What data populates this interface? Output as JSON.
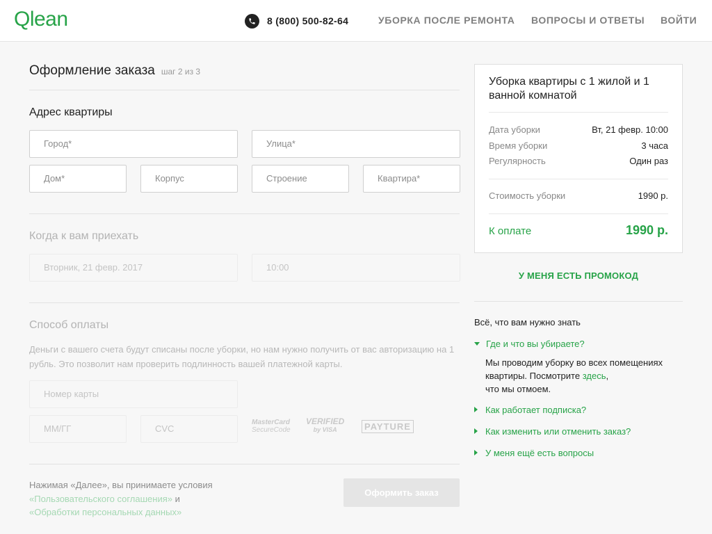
{
  "header": {
    "logo": "Qlean",
    "phone": "8 (800) 500-82-64",
    "nav": [
      "Уборка после ремонта",
      "Вопросы и ответы",
      "Войти"
    ]
  },
  "colors": {
    "accent": "#27a348",
    "background": "#f7f7f7"
  },
  "icons": {
    "phone": "phone-icon"
  },
  "checkout": {
    "title": "Оформление заказа",
    "step": "шаг 2 из 3",
    "address": {
      "heading": "Адрес квартиры",
      "city_placeholder": "Город*",
      "street_placeholder": "Улица*",
      "house_placeholder": "Дом*",
      "building_placeholder": "Корпус",
      "structure_placeholder": "Строение",
      "apartment_placeholder": "Квартира*"
    },
    "when": {
      "heading": "Когда к вам приехать",
      "date": "Вторник, 21 февр. 2017",
      "time": "10:00"
    },
    "payment": {
      "heading": "Способ оплаты",
      "note": "Деньги с вашего счета будут списаны после уборки, но нам нужно получить от вас авторизацию на 1 рубль. Это позволит нам проверить подлинность вашей платежной карты.",
      "card_placeholder": "Номер карты",
      "expiry_placeholder": "ММ/ГГ",
      "cvc_placeholder": "CVC",
      "logos": {
        "mastercard": "MasterCard",
        "mastercard_sub": "SecureCode",
        "verified": "VERIFIED",
        "verified_sub": "by VISA",
        "payture": "PAYTURE"
      }
    },
    "terms": {
      "text_before": "Нажимая «Далее», вы принимаете условия",
      "link1": "«Пользовательского соглашения»",
      "and": "и",
      "link2": "«Обработки персональных данных»"
    },
    "submit_label": "Оформить заказ"
  },
  "summary": {
    "title": "Уборка квартиры с 1 жилой и 1 ванной комнатой",
    "rows": [
      {
        "label": "Дата уборки",
        "value": "Вт, 21 февр. 10:00"
      },
      {
        "label": "Время уборки",
        "value": "3 часа"
      },
      {
        "label": "Регулярность",
        "value": "Один раз"
      }
    ],
    "cost_label": "Стоимость уборки",
    "cost_value": "1990 р.",
    "total_label": "К оплате",
    "total_value": "1990 р."
  },
  "promo_label": "У меня есть промокод",
  "faq": {
    "heading": "Всё, что вам нужно знать",
    "open_question": "Где и что вы убираете?",
    "answer_before": "Мы проводим уборку во всех помещениях квартиры. Посмотрите",
    "answer_link": "здесь",
    "answer_after": "что мы отмоем.",
    "questions": [
      "Как работает подписка?",
      "Как изменить или отменить заказ?",
      "У меня ещё есть вопросы"
    ]
  }
}
